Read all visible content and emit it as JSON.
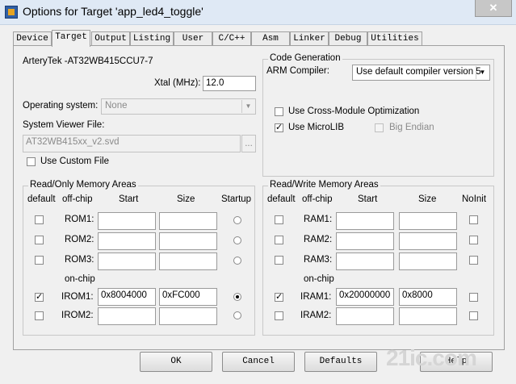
{
  "window": {
    "title": "Options for Target 'app_led4_toggle'",
    "close_glyph": "✕"
  },
  "tabs": [
    "Device",
    "Target",
    "Output",
    "Listing",
    "User",
    "C/C++",
    "Asm",
    "Linker",
    "Debug",
    "Utilities"
  ],
  "active_tab": "Target",
  "target": {
    "device": "ArteryTek -AT32WB415CCU7-7",
    "xtal_label": "Xtal (MHz):",
    "xtal_value": "12.0",
    "os_label": "Operating system:",
    "os_value": "None",
    "svd_label": "System Viewer File:",
    "svd_value": "AT32WB415xx_v2.svd",
    "browse_label": "...",
    "use_custom_file": "Use Custom File"
  },
  "codegen": {
    "legend": "Code Generation",
    "arm_compiler_label": "ARM Compiler:",
    "arm_compiler_value": "Use default compiler version 5",
    "cross_module": "Use Cross-Module Optimization",
    "microlib": "Use MicroLIB",
    "big_endian": "Big Endian"
  },
  "ro_memory": {
    "legend": "Read/Only Memory Areas",
    "headers": {
      "default": "default",
      "offchip": "off-chip",
      "start": "Start",
      "size": "Size",
      "startup": "Startup"
    },
    "onchip_label": "on-chip",
    "rows": [
      {
        "label": "ROM1:",
        "start": "",
        "size": "",
        "default": false,
        "startup": false
      },
      {
        "label": "ROM2:",
        "start": "",
        "size": "",
        "default": false,
        "startup": false
      },
      {
        "label": "ROM3:",
        "start": "",
        "size": "",
        "default": false,
        "startup": false
      },
      {
        "label": "IROM1:",
        "start": "0x8004000",
        "size": "0xFC000",
        "default": true,
        "startup": true
      },
      {
        "label": "IROM2:",
        "start": "",
        "size": "",
        "default": false,
        "startup": false
      }
    ]
  },
  "rw_memory": {
    "legend": "Read/Write Memory Areas",
    "headers": {
      "default": "default",
      "offchip": "off-chip",
      "start": "Start",
      "size": "Size",
      "noinit": "NoInit"
    },
    "onchip_label": "on-chip",
    "rows": [
      {
        "label": "RAM1:",
        "start": "",
        "size": "",
        "default": false
      },
      {
        "label": "RAM2:",
        "start": "",
        "size": "",
        "default": false
      },
      {
        "label": "RAM3:",
        "start": "",
        "size": "",
        "default": false
      },
      {
        "label": "IRAM1:",
        "start": "0x20000000",
        "size": "0x8000",
        "default": true
      },
      {
        "label": "IRAM2:",
        "start": "",
        "size": "",
        "default": false
      }
    ]
  },
  "buttons": {
    "ok": "OK",
    "cancel": "Cancel",
    "defaults": "Defaults",
    "help": "Help"
  },
  "watermark": "21ic.com"
}
